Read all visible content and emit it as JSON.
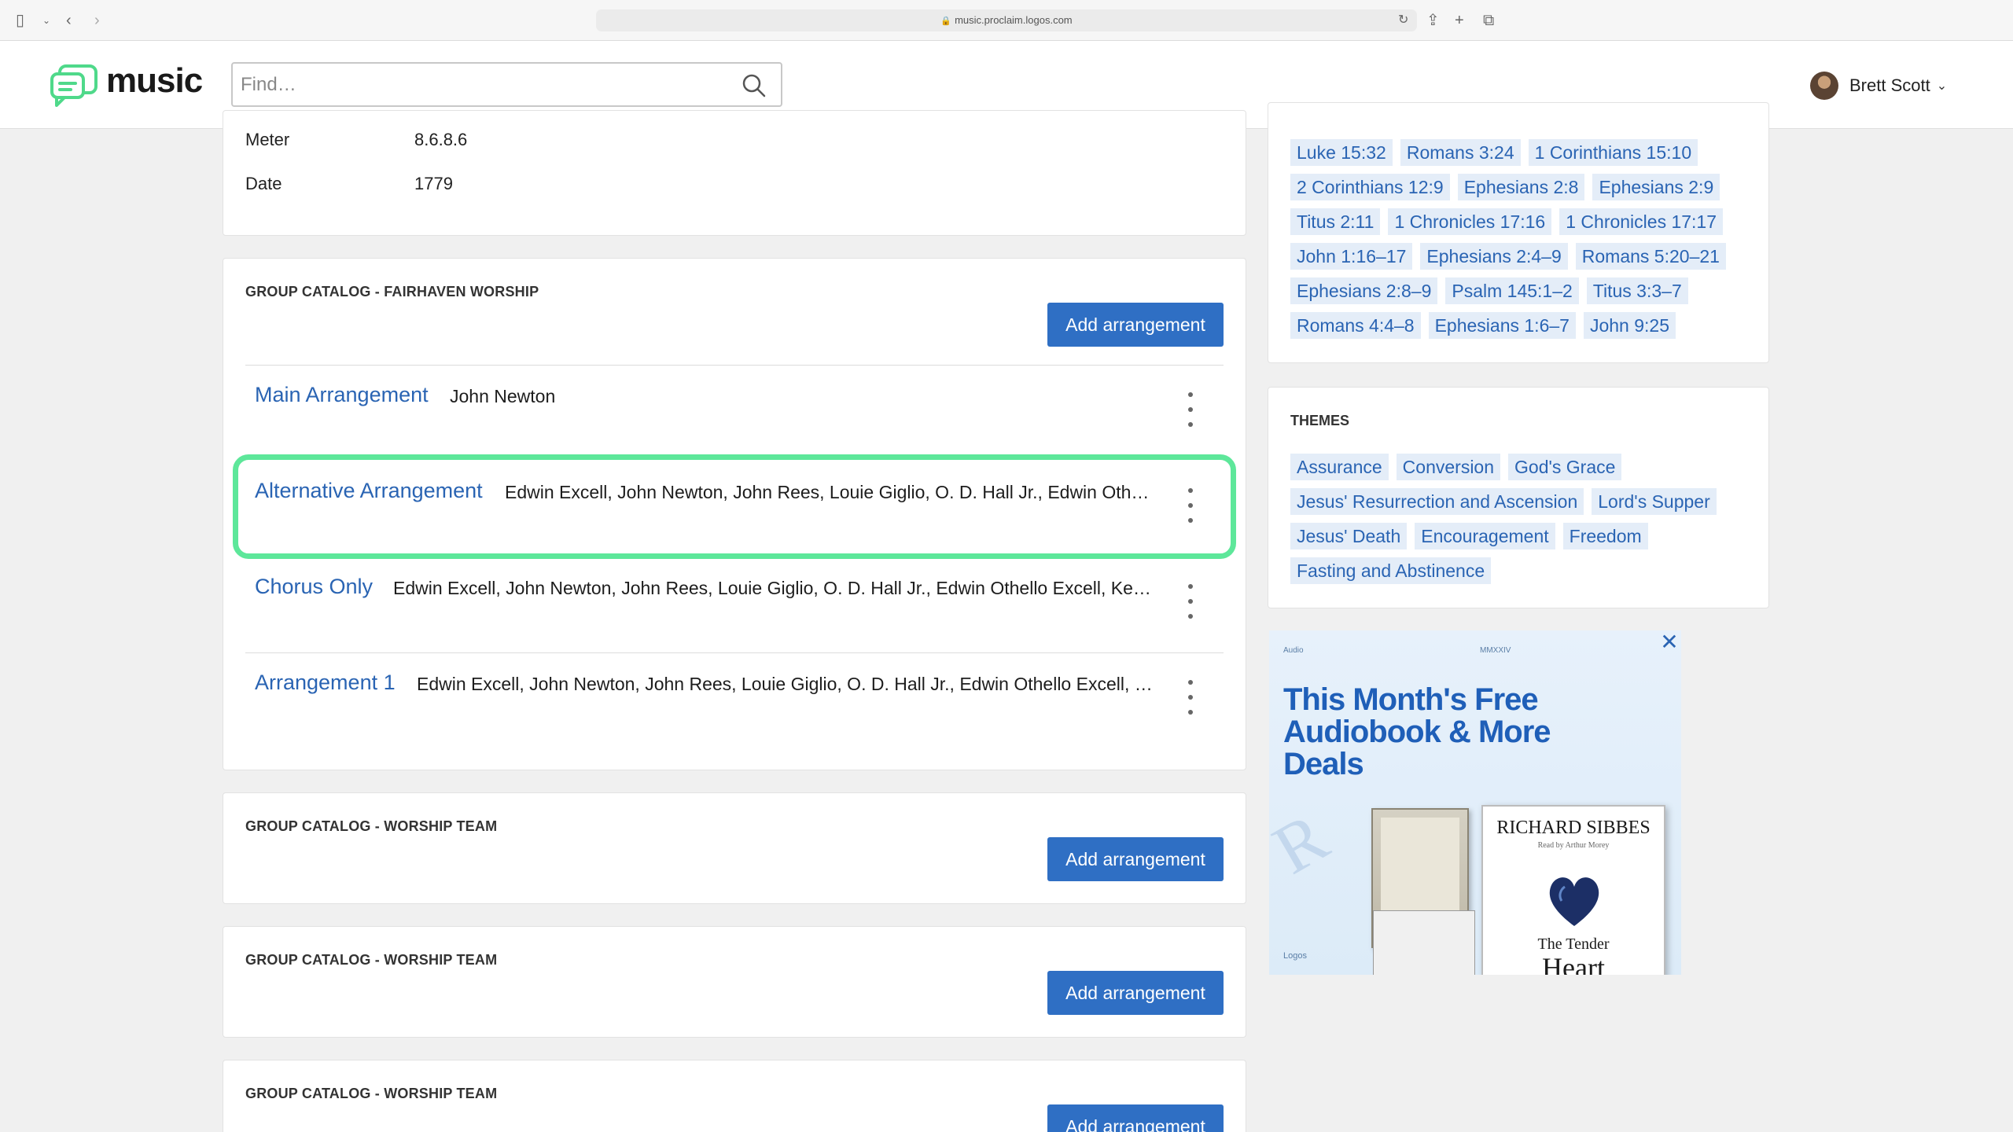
{
  "browser": {
    "url": "music.proclaim.logos.com"
  },
  "header": {
    "logo_text": "music",
    "search_placeholder": "Find…",
    "user_name": "Brett Scott"
  },
  "song_meta": [
    {
      "label": "Meter",
      "value": "8.6.8.6"
    },
    {
      "label": "Date",
      "value": "1779"
    }
  ],
  "catalogs": [
    {
      "title": "GROUP CATALOG - FAIRHAVEN WORSHIP",
      "add_label": "Add arrangement",
      "arrangements": [
        {
          "name": "Main Arrangement",
          "authors": "John Newton"
        },
        {
          "name": "Alternative Arrangement",
          "authors": "Edwin Excell, John Newton, John Rees, Louie Giglio, O. D. Hall Jr., Edwin Othel…"
        },
        {
          "name": "Chorus Only",
          "authors": "Edwin Excell, John Newton, John Rees, Louie Giglio, O. D. Hall Jr., Edwin Othello Excell, Ken …"
        },
        {
          "name": "Arrangement 1",
          "authors": "Edwin Excell, John Newton, John Rees, Louie Giglio, O. D. Hall Jr., Edwin Othello Excell, K…"
        }
      ]
    },
    {
      "title": "GROUP CATALOG - WORSHIP TEAM",
      "add_label": "Add arrangement"
    },
    {
      "title": "GROUP CATALOG - WORSHIP TEAM",
      "add_label": "Add arrangement"
    },
    {
      "title": "GROUP CATALOG - WORSHIP TEAM",
      "add_label": "Add arrangement"
    }
  ],
  "scripture_refs": [
    "Luke 15:32",
    "Romans 3:24",
    "1 Corinthians 15:10",
    "2 Corinthians 12:9",
    "Ephesians 2:8",
    "Ephesians 2:9",
    "Titus 2:11",
    "1 Chronicles 17:16",
    "1 Chronicles 17:17",
    "John 1:16–17",
    "Ephesians 2:4–9",
    "Romans 5:20–21",
    "Ephesians 2:8–9",
    "Psalm 145:1–2",
    "Titus 3:3–7",
    "Romans 4:4–8",
    "Ephesians 1:6–7",
    "John 9:25"
  ],
  "themes": {
    "title": "THEMES",
    "items": [
      "Assurance",
      "Conversion",
      "God's Grace",
      "Jesus' Resurrection and Ascension",
      "Lord's Supper",
      "Jesus' Death",
      "Encouragement",
      "Freedom",
      "Fasting and Abstinence"
    ]
  },
  "ad": {
    "tag_left": "Audio",
    "tag_right": "MMXXIV",
    "headline": "This Month's Free Audiobook & More Deals",
    "book_author": "RICHARD SIBBES",
    "book_reader": "Read by Arthur Morey",
    "book_title_1": "The Tender",
    "book_title_2": "Heart",
    "brand": "Logos",
    "close_label": "✕"
  },
  "colors": {
    "accent": "#2f6fc4",
    "link": "#2a64b3",
    "highlight": "#5de79a",
    "tag_bg": "#e4edf8"
  }
}
